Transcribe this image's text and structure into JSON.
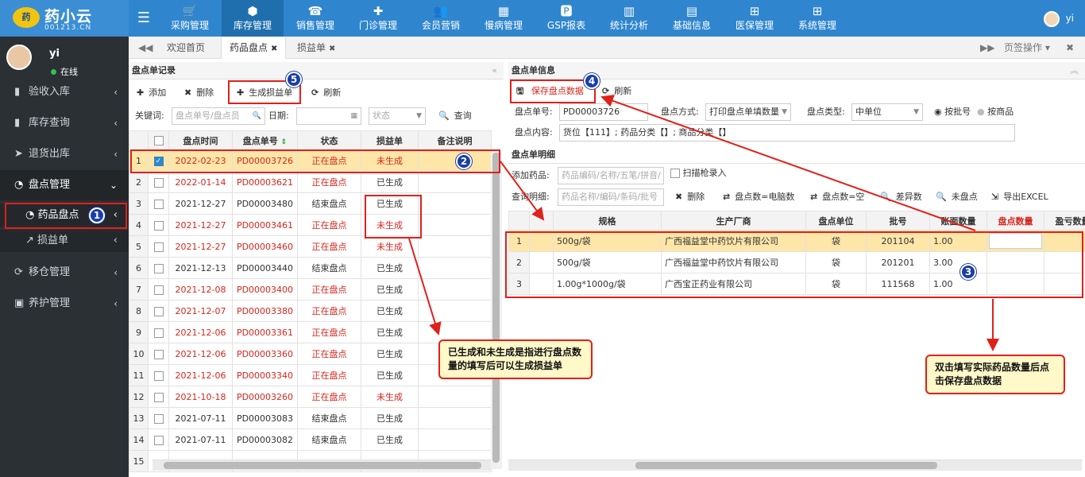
{
  "logo": {
    "mark": "药",
    "name": "药小云",
    "sub": "001213.CN"
  },
  "nav": [
    {
      "label": "采购管理",
      "icon": "cart-icon",
      "glyph": "🛒"
    },
    {
      "label": "库存管理",
      "icon": "box-icon",
      "glyph": "⬢"
    },
    {
      "label": "销售管理",
      "icon": "register-icon",
      "glyph": "☎"
    },
    {
      "label": "门诊管理",
      "icon": "medkit-icon",
      "glyph": "✚"
    },
    {
      "label": "会员营销",
      "icon": "users-icon",
      "glyph": "👥"
    },
    {
      "label": "慢病管理",
      "icon": "hospital-icon",
      "glyph": "▦"
    },
    {
      "label": "GSP报表",
      "icon": "report-icon",
      "glyph": "🅿"
    },
    {
      "label": "统计分析",
      "icon": "bar-chart-icon",
      "glyph": "▥"
    },
    {
      "label": "基础信息",
      "icon": "book-icon",
      "glyph": "▤"
    },
    {
      "label": "医保管理",
      "icon": "windows-icon",
      "glyph": "⊞"
    },
    {
      "label": "系统管理",
      "icon": "windows-icon",
      "glyph": "⊞"
    }
  ],
  "user": {
    "name": "yi",
    "status": "在线"
  },
  "sidebar": [
    {
      "label": "验收入库",
      "glyph": "▮"
    },
    {
      "label": "库存查询",
      "glyph": "▮"
    },
    {
      "label": "退货出库",
      "glyph": "➤"
    },
    {
      "label": "盘点管理",
      "glyph": "◔"
    },
    {
      "label": "药品盘点",
      "glyph": "◔"
    },
    {
      "label": "损益单",
      "glyph": "↗"
    },
    {
      "label": "移仓管理",
      "glyph": "⟳"
    },
    {
      "label": "养护管理",
      "glyph": "▣"
    }
  ],
  "tabs": [
    {
      "label": "欢迎首页"
    },
    {
      "label": "药品盘点"
    },
    {
      "label": "损益单"
    }
  ],
  "tab_ops": "页签操作",
  "left": {
    "title": "盘点单记录",
    "toolbar": {
      "add": "添加",
      "delete": "删除",
      "gen": "生成损益单",
      "refresh": "刷新"
    },
    "search": {
      "keyword_label": "关键词:",
      "keyword_ph": "盘点单号/盘点员",
      "date_label": "日期:",
      "status_ph": "状态",
      "query": "查询"
    },
    "columns": [
      "盘点时间",
      "盘点单号",
      "状态",
      "损益单",
      "备注说明"
    ],
    "rows": [
      {
        "n": "1",
        "date": "2022-02-23",
        "no": "PD00003726",
        "status": "正在盘点",
        "loss": "未生成"
      },
      {
        "n": "2",
        "date": "2022-01-14",
        "no": "PD00003621",
        "status": "正在盘点",
        "loss": "已生成"
      },
      {
        "n": "3",
        "date": "2021-12-27",
        "no": "PD00003480",
        "status": "结束盘点",
        "loss": "已生成"
      },
      {
        "n": "4",
        "date": "2021-12-27",
        "no": "PD00003461",
        "status": "正在盘点",
        "loss": "未生成"
      },
      {
        "n": "5",
        "date": "2021-12-27",
        "no": "PD00003460",
        "status": "正在盘点",
        "loss": "未生成"
      },
      {
        "n": "6",
        "date": "2021-12-13",
        "no": "PD00003440",
        "status": "结束盘点",
        "loss": "已生成"
      },
      {
        "n": "7",
        "date": "2021-12-08",
        "no": "PD00003400",
        "status": "正在盘点",
        "loss": "已生成"
      },
      {
        "n": "8",
        "date": "2021-12-07",
        "no": "PD00003380",
        "status": "正在盘点",
        "loss": "已生成"
      },
      {
        "n": "9",
        "date": "2021-12-06",
        "no": "PD00003361",
        "status": "正在盘点",
        "loss": "已生成"
      },
      {
        "n": "10",
        "date": "2021-12-06",
        "no": "PD00003360",
        "status": "正在盘点",
        "loss": "已生成"
      },
      {
        "n": "11",
        "date": "2021-12-06",
        "no": "PD00003340",
        "status": "正在盘点",
        "loss": "已生成"
      },
      {
        "n": "12",
        "date": "2021-10-18",
        "no": "PD00003260",
        "status": "正在盘点",
        "loss": "未生成"
      },
      {
        "n": "13",
        "date": "2021-07-11",
        "no": "PD00003083",
        "status": "结束盘点",
        "loss": "已生成"
      },
      {
        "n": "14",
        "date": "2021-07-11",
        "no": "PD00003082",
        "status": "结束盘点",
        "loss": "已生成"
      },
      {
        "n": "15"
      }
    ]
  },
  "right": {
    "title": "盘点单信息",
    "save": "保存盘点数据",
    "refresh": "刷新",
    "no_label": "盘点单号:",
    "no": "PD00003726",
    "mode_label": "盘点方式:",
    "mode": "打印盘点单填数量",
    "type_label": "盘点类型:",
    "type": "中单位",
    "radio1": "按批号",
    "radio2": "按商品",
    "content_label": "盘点内容:",
    "content": "货位【111】; 药品分类【】; 商品分类【】",
    "detail_title": "盘点单明细",
    "add_label": "添加药品:",
    "add_ph": "药品编码/名称/五笔/拼音/条",
    "scan": "扫描枪录入",
    "query_label": "查询明细:",
    "query_ph": "药品名称/编码/条码/批号",
    "tools": {
      "del": "删除",
      "eq_pc": "盘点数=电脑数",
      "eq_empty": "盘点数=空",
      "diff": "差异数",
      "none": "未盘点",
      "excel": "导出EXCEL"
    },
    "columns": [
      "规格",
      "生产厂商",
      "盘点单位",
      "批号",
      "账面数量",
      "盘点数量",
      "盈亏数量"
    ],
    "rows": [
      {
        "n": "1",
        "spec": "500g/袋",
        "maker": "广西福益堂中药饮片有限公司",
        "unit": "袋",
        "batch": "201104",
        "book": "1.00"
      },
      {
        "n": "2",
        "spec": "500g/袋",
        "maker": "广西福益堂中药饮片有限公司",
        "unit": "袋",
        "batch": "201201",
        "book": "3.00"
      },
      {
        "n": "3",
        "spec": "1.00g*1000g/袋",
        "maker": "广西宝正药业有限公司",
        "unit": "袋",
        "batch": "111568",
        "book": "1.00"
      }
    ]
  },
  "notes": {
    "n1": "已生成和未生成是指进行盘点数量的填写后可以生成损益单",
    "n2": "双击填写实际药品数量后点击保存盘点数据"
  },
  "badges": [
    "1",
    "2",
    "3",
    "4",
    "5"
  ]
}
